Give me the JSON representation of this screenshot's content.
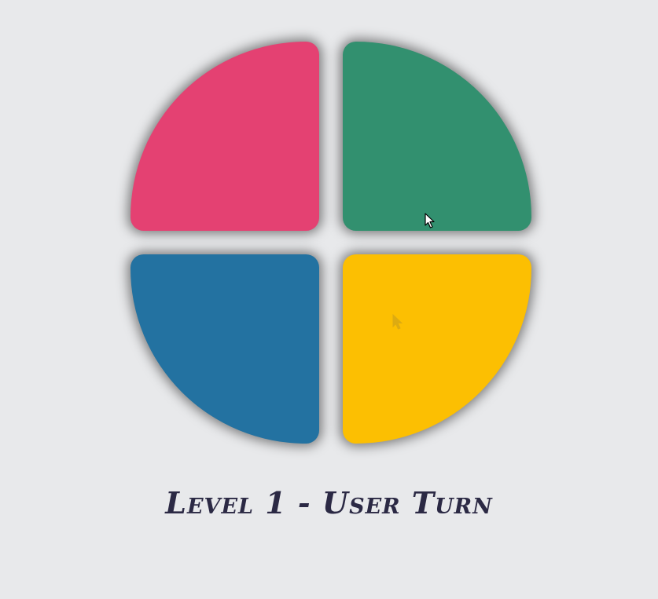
{
  "game": {
    "pads": {
      "top_left": {
        "color_name": "pink-red",
        "color": "#e44172"
      },
      "top_right": {
        "color_name": "green",
        "color": "#32906f"
      },
      "bottom_left": {
        "color_name": "blue",
        "color": "#2372a1"
      },
      "bottom_right": {
        "color_name": "yellow",
        "color": "#fcbf02"
      }
    },
    "status_text": "Level 1 - User Turn"
  },
  "colors": {
    "background": "#e8e9eb",
    "status_text": "#2b2944"
  },
  "icons": {
    "pointer": "mouse-pointer-icon"
  }
}
